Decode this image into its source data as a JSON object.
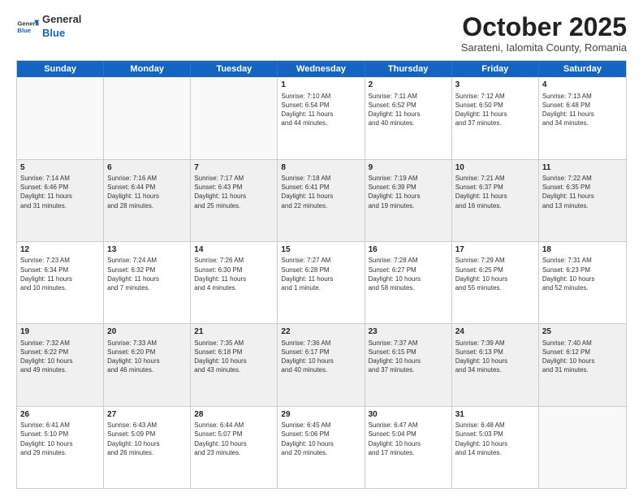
{
  "header": {
    "logo": {
      "general": "General",
      "blue": "Blue"
    },
    "title": "October 2025",
    "subtitle": "Sarateni, Ialomita County, Romania"
  },
  "days": [
    "Sunday",
    "Monday",
    "Tuesday",
    "Wednesday",
    "Thursday",
    "Friday",
    "Saturday"
  ],
  "rows": [
    [
      {
        "day": "",
        "empty": true
      },
      {
        "day": "",
        "empty": true
      },
      {
        "day": "",
        "empty": true
      },
      {
        "day": "1",
        "line1": "Sunrise: 7:10 AM",
        "line2": "Sunset: 6:54 PM",
        "line3": "Daylight: 11 hours",
        "line4": "and 44 minutes."
      },
      {
        "day": "2",
        "line1": "Sunrise: 7:11 AM",
        "line2": "Sunset: 6:52 PM",
        "line3": "Daylight: 11 hours",
        "line4": "and 40 minutes."
      },
      {
        "day": "3",
        "line1": "Sunrise: 7:12 AM",
        "line2": "Sunset: 6:50 PM",
        "line3": "Daylight: 11 hours",
        "line4": "and 37 minutes."
      },
      {
        "day": "4",
        "line1": "Sunrise: 7:13 AM",
        "line2": "Sunset: 6:48 PM",
        "line3": "Daylight: 11 hours",
        "line4": "and 34 minutes."
      }
    ],
    [
      {
        "day": "5",
        "line1": "Sunrise: 7:14 AM",
        "line2": "Sunset: 6:46 PM",
        "line3": "Daylight: 11 hours",
        "line4": "and 31 minutes."
      },
      {
        "day": "6",
        "line1": "Sunrise: 7:16 AM",
        "line2": "Sunset: 6:44 PM",
        "line3": "Daylight: 11 hours",
        "line4": "and 28 minutes."
      },
      {
        "day": "7",
        "line1": "Sunrise: 7:17 AM",
        "line2": "Sunset: 6:43 PM",
        "line3": "Daylight: 11 hours",
        "line4": "and 25 minutes."
      },
      {
        "day": "8",
        "line1": "Sunrise: 7:18 AM",
        "line2": "Sunset: 6:41 PM",
        "line3": "Daylight: 11 hours",
        "line4": "and 22 minutes."
      },
      {
        "day": "9",
        "line1": "Sunrise: 7:19 AM",
        "line2": "Sunset: 6:39 PM",
        "line3": "Daylight: 11 hours",
        "line4": "and 19 minutes."
      },
      {
        "day": "10",
        "line1": "Sunrise: 7:21 AM",
        "line2": "Sunset: 6:37 PM",
        "line3": "Daylight: 11 hours",
        "line4": "and 16 minutes."
      },
      {
        "day": "11",
        "line1": "Sunrise: 7:22 AM",
        "line2": "Sunset: 6:35 PM",
        "line3": "Daylight: 11 hours",
        "line4": "and 13 minutes."
      }
    ],
    [
      {
        "day": "12",
        "line1": "Sunrise: 7:23 AM",
        "line2": "Sunset: 6:34 PM",
        "line3": "Daylight: 11 hours",
        "line4": "and 10 minutes."
      },
      {
        "day": "13",
        "line1": "Sunrise: 7:24 AM",
        "line2": "Sunset: 6:32 PM",
        "line3": "Daylight: 11 hours",
        "line4": "and 7 minutes."
      },
      {
        "day": "14",
        "line1": "Sunrise: 7:26 AM",
        "line2": "Sunset: 6:30 PM",
        "line3": "Daylight: 11 hours",
        "line4": "and 4 minutes."
      },
      {
        "day": "15",
        "line1": "Sunrise: 7:27 AM",
        "line2": "Sunset: 6:28 PM",
        "line3": "Daylight: 11 hours",
        "line4": "and 1 minute."
      },
      {
        "day": "16",
        "line1": "Sunrise: 7:28 AM",
        "line2": "Sunset: 6:27 PM",
        "line3": "Daylight: 10 hours",
        "line4": "and 58 minutes."
      },
      {
        "day": "17",
        "line1": "Sunrise: 7:29 AM",
        "line2": "Sunset: 6:25 PM",
        "line3": "Daylight: 10 hours",
        "line4": "and 55 minutes."
      },
      {
        "day": "18",
        "line1": "Sunrise: 7:31 AM",
        "line2": "Sunset: 6:23 PM",
        "line3": "Daylight: 10 hours",
        "line4": "and 52 minutes."
      }
    ],
    [
      {
        "day": "19",
        "line1": "Sunrise: 7:32 AM",
        "line2": "Sunset: 6:22 PM",
        "line3": "Daylight: 10 hours",
        "line4": "and 49 minutes."
      },
      {
        "day": "20",
        "line1": "Sunrise: 7:33 AM",
        "line2": "Sunset: 6:20 PM",
        "line3": "Daylight: 10 hours",
        "line4": "and 46 minutes."
      },
      {
        "day": "21",
        "line1": "Sunrise: 7:35 AM",
        "line2": "Sunset: 6:18 PM",
        "line3": "Daylight: 10 hours",
        "line4": "and 43 minutes."
      },
      {
        "day": "22",
        "line1": "Sunrise: 7:36 AM",
        "line2": "Sunset: 6:17 PM",
        "line3": "Daylight: 10 hours",
        "line4": "and 40 minutes."
      },
      {
        "day": "23",
        "line1": "Sunrise: 7:37 AM",
        "line2": "Sunset: 6:15 PM",
        "line3": "Daylight: 10 hours",
        "line4": "and 37 minutes."
      },
      {
        "day": "24",
        "line1": "Sunrise: 7:39 AM",
        "line2": "Sunset: 6:13 PM",
        "line3": "Daylight: 10 hours",
        "line4": "and 34 minutes."
      },
      {
        "day": "25",
        "line1": "Sunrise: 7:40 AM",
        "line2": "Sunset: 6:12 PM",
        "line3": "Daylight: 10 hours",
        "line4": "and 31 minutes."
      }
    ],
    [
      {
        "day": "26",
        "line1": "Sunrise: 6:41 AM",
        "line2": "Sunset: 5:10 PM",
        "line3": "Daylight: 10 hours",
        "line4": "and 29 minutes."
      },
      {
        "day": "27",
        "line1": "Sunrise: 6:43 AM",
        "line2": "Sunset: 5:09 PM",
        "line3": "Daylight: 10 hours",
        "line4": "and 26 minutes."
      },
      {
        "day": "28",
        "line1": "Sunrise: 6:44 AM",
        "line2": "Sunset: 5:07 PM",
        "line3": "Daylight: 10 hours",
        "line4": "and 23 minutes."
      },
      {
        "day": "29",
        "line1": "Sunrise: 6:45 AM",
        "line2": "Sunset: 5:06 PM",
        "line3": "Daylight: 10 hours",
        "line4": "and 20 minutes."
      },
      {
        "day": "30",
        "line1": "Sunrise: 6:47 AM",
        "line2": "Sunset: 5:04 PM",
        "line3": "Daylight: 10 hours",
        "line4": "and 17 minutes."
      },
      {
        "day": "31",
        "line1": "Sunrise: 6:48 AM",
        "line2": "Sunset: 5:03 PM",
        "line3": "Daylight: 10 hours",
        "line4": "and 14 minutes."
      },
      {
        "day": "",
        "empty": true
      }
    ]
  ]
}
